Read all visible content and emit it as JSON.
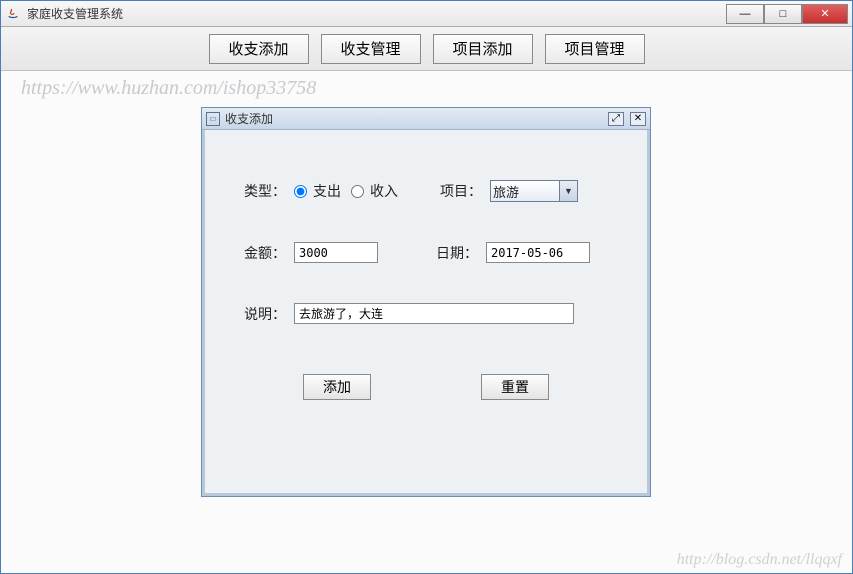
{
  "window": {
    "title": "家庭收支管理系统"
  },
  "toolbar": {
    "add_tx": "收支添加",
    "manage_tx": "收支管理",
    "add_item": "项目添加",
    "manage_item": "项目管理"
  },
  "internal_frame": {
    "title": "收支添加"
  },
  "form": {
    "type_label": "类型：",
    "type_expense": "支出",
    "type_income": "收入",
    "project_label": "项目：",
    "project_value": "旅游",
    "amount_label": "金额：",
    "amount_value": "3000",
    "date_label": "日期：",
    "date_value": "2017-05-06",
    "desc_label": "说明：",
    "desc_value": "去旅游了，大连",
    "add_btn": "添加",
    "reset_btn": "重置"
  },
  "watermark_top": "https://www.huzhan.com/ishop33758",
  "watermark_bottom": "http://blog.csdn.net/llqqxf"
}
